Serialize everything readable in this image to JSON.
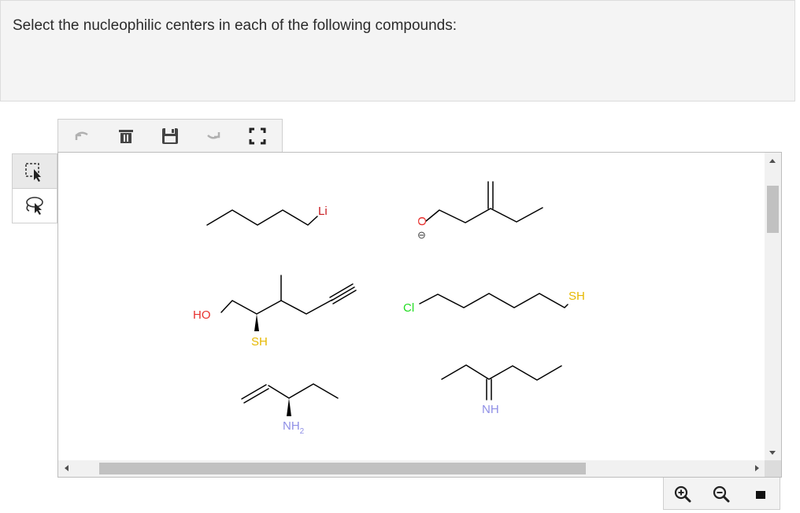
{
  "question": {
    "text": "Select the nucleophilic centers in each of the following compounds:"
  },
  "toolbar": {
    "buttons": [
      "undo-icon",
      "clear-icon",
      "save-icon",
      "redo-icon",
      "fullscreen-icon"
    ]
  },
  "left_tools": {
    "buttons": [
      "select-tool-icon",
      "lasso-tool-icon"
    ],
    "active": "select-tool-icon"
  },
  "zoom_controls": {
    "buttons": [
      "zoom-in-icon",
      "zoom-out-icon",
      "stop-icon"
    ]
  },
  "molecules": {
    "m1": {
      "li": "Li"
    },
    "m2": {
      "o": "O",
      "charge": "⊖"
    },
    "m3": {
      "ho": "HO",
      "sh": "SH"
    },
    "m4": {
      "cl": "Cl",
      "sh": "SH"
    },
    "m5": {
      "nh": "NH"
    },
    "m6": {
      "nh": "NH",
      "sub": "2"
    }
  },
  "colors": {
    "oxygen": "#e8322f",
    "sulfur": "#e6b800",
    "chlorine": "#22dd22",
    "nitrogen": "#8f8fe6",
    "lithium": "#c8181e",
    "bond": "#000000"
  }
}
